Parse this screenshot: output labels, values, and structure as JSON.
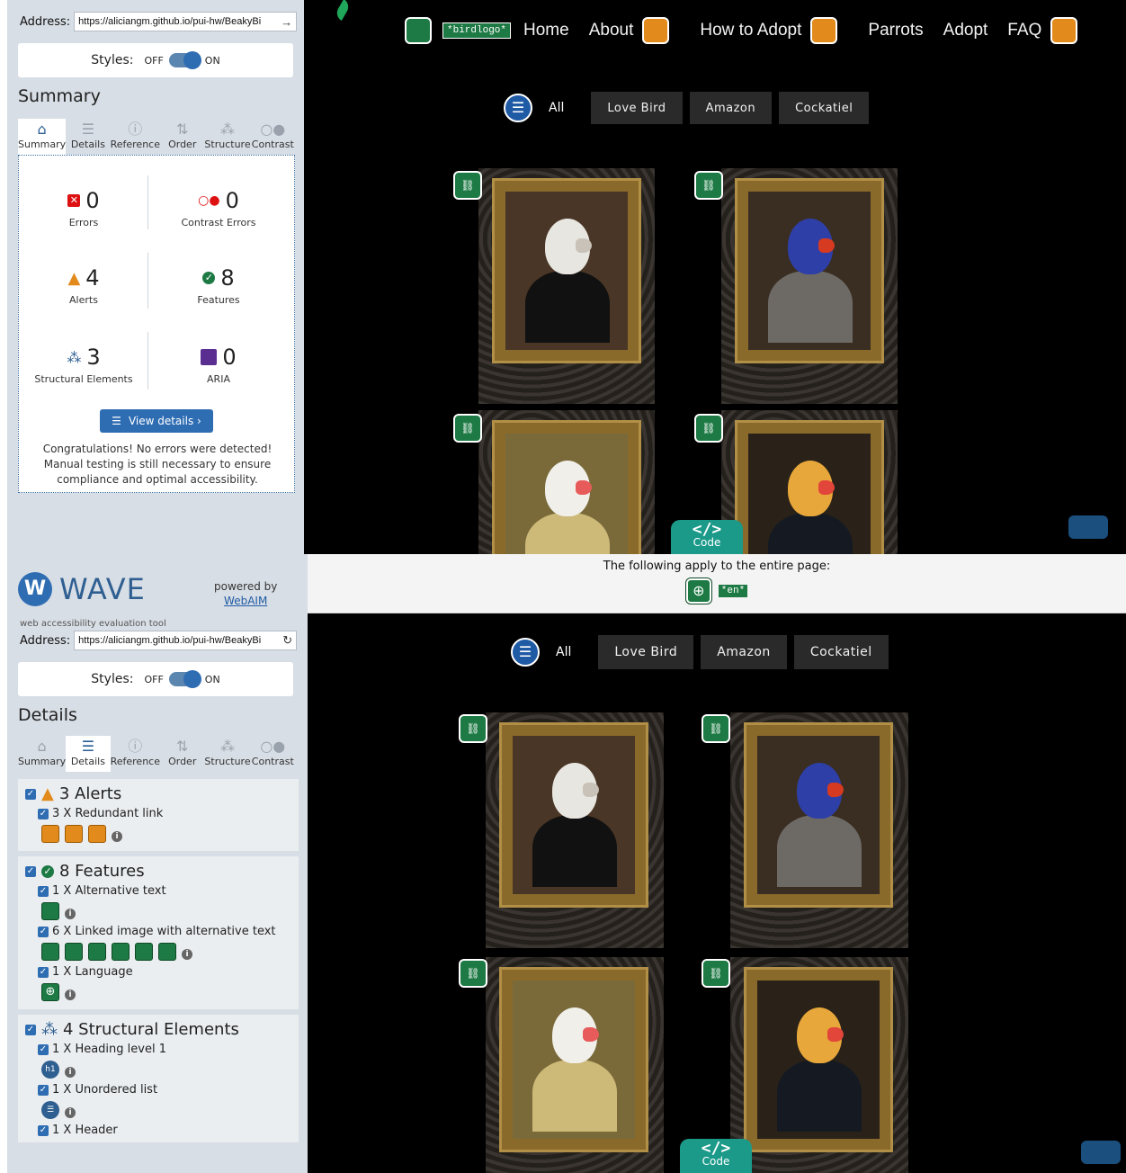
{
  "top": {
    "address": {
      "label": "Address:",
      "url": "https://aliciangm.github.io/pui-hw/BeakyBi",
      "go_icon": "arrow-right-icon"
    },
    "styles": {
      "label": "Styles:",
      "off": "OFF",
      "on": "ON"
    },
    "section_title": "Summary",
    "tabs": [
      "Summary",
      "Details",
      "Reference",
      "Order",
      "Structure",
      "Contrast"
    ],
    "active_tab": "Summary",
    "stats": {
      "errors": {
        "value": "0",
        "label": "Errors"
      },
      "contrast_errors": {
        "value": "0",
        "label": "Contrast Errors"
      },
      "alerts": {
        "value": "4",
        "label": "Alerts"
      },
      "features": {
        "value": "8",
        "label": "Features"
      },
      "structural": {
        "value": "3",
        "label": "Structural Elements"
      },
      "aria": {
        "value": "0",
        "label": "ARIA"
      }
    },
    "view_details": "View details ›",
    "congrats": "Congratulations! No errors were detected! Manual testing is still necessary to ensure compliance and optimal accessibility.",
    "nav": {
      "birdlogo": "*birdlogo*",
      "items": [
        "Home",
        "About",
        "How to Adopt",
        "Parrots",
        "Adopt",
        "FAQ"
      ]
    },
    "filters": {
      "all": "All",
      "buttons": [
        "Love Bird",
        "Amazon",
        "Cockatiel"
      ]
    },
    "code_tab": {
      "symbol": "</>",
      "label": "Code"
    }
  },
  "bottom": {
    "wave": {
      "name": "WAVE",
      "tagline": "web accessibility evaluation tool",
      "powered_by": "powered by",
      "webaim": "WebAIM"
    },
    "address": {
      "label": "Address:",
      "url": "https://aliciangm.github.io/pui-hw/BeakyBi",
      "reload_icon": "reload-icon"
    },
    "styles": {
      "label": "Styles:",
      "off": "OFF",
      "on": "ON"
    },
    "section_title": "Details",
    "tabs": [
      "Summary",
      "Details",
      "Reference",
      "Order",
      "Structure",
      "Contrast"
    ],
    "active_tab": "Details",
    "groups": [
      {
        "title": "3 Alerts",
        "items": [
          {
            "label": "3 X Redundant link"
          }
        ]
      },
      {
        "title": "8 Features",
        "items": [
          {
            "label": "1 X Alternative text"
          },
          {
            "label": "6 X Linked image with alternative text"
          },
          {
            "label": "1 X Language"
          }
        ]
      },
      {
        "title": "4 Structural Elements",
        "items": [
          {
            "label": "1 X Heading level 1"
          },
          {
            "label": "1 X Unordered list"
          },
          {
            "label": "1 X Header"
          }
        ]
      }
    ],
    "apply_text": "The following apply to the entire page:",
    "lang_tag": "*en*",
    "filters": {
      "all": "All",
      "buttons": [
        "Love Bird",
        "Amazon",
        "Cockatiel"
      ]
    },
    "code_tab": {
      "symbol": "</>",
      "label": "Code"
    }
  },
  "colors": {
    "wave_blue": "#2f6db3",
    "feature_green": "#1d7a44",
    "alert_orange": "#e28b1c",
    "page_bg": "#000000",
    "code_teal": "#1b9a8a"
  }
}
